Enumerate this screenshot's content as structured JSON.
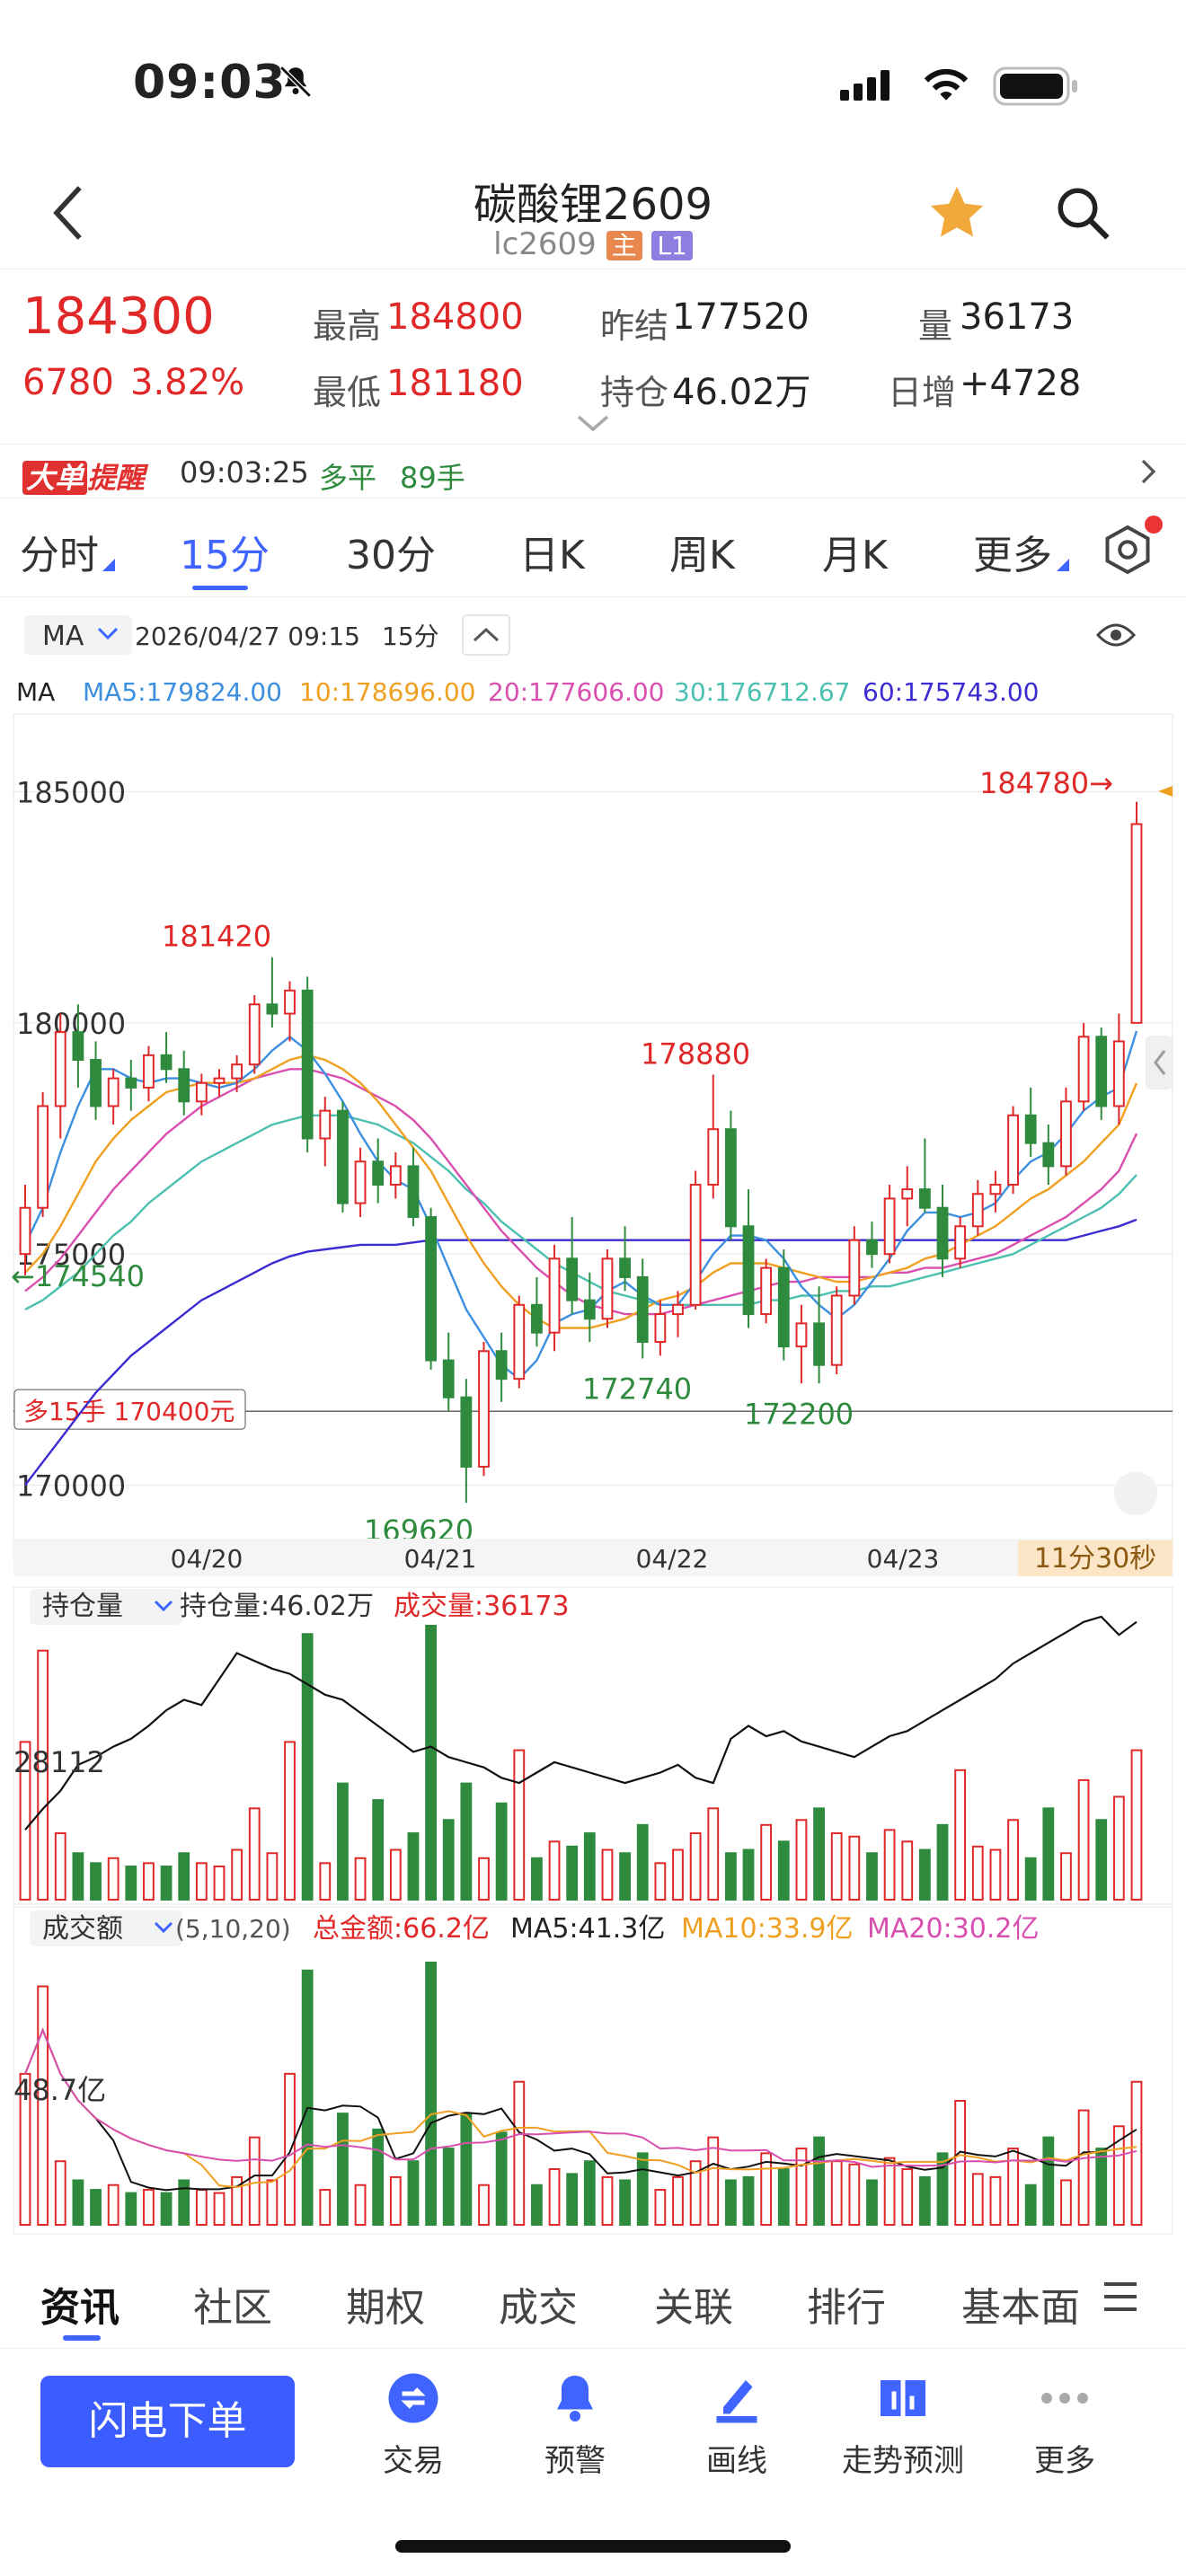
{
  "status_bar": {
    "time": "09:03"
  },
  "header": {
    "title": "碳酸锂2609",
    "code": "lc2609",
    "badge_main": "主",
    "badge_l1": "L1"
  },
  "quote": {
    "last_price": "184300",
    "change": "6780",
    "change_pct": "3.82%",
    "high_label": "最高",
    "high": "184800",
    "low_label": "最低",
    "low": "181180",
    "prev_settle_label": "昨结",
    "prev_settle": "177520",
    "oi_label": "持仓",
    "oi": "46.02万",
    "vol_label": "量",
    "vol": "36173",
    "daily_inc_label": "日增",
    "daily_inc": "+4728"
  },
  "alert": {
    "tag1": "大单",
    "tag2": "提醒",
    "time": "09:03:25",
    "type": "多平",
    "qty": "89手"
  },
  "period_tabs": [
    "分时",
    "15分",
    "30分",
    "日K",
    "周K",
    "月K",
    "更多"
  ],
  "active_period": "15分",
  "chart_header": {
    "indicator": "MA",
    "datetime": "2026/04/27 09:15",
    "period": "15分"
  },
  "ma_legend": {
    "label": "MA",
    "ma5": "MA5:179824.00",
    "ma10": "10:178696.00",
    "ma20": "20:177606.00",
    "ma30": "30:176712.67",
    "ma60": "60:175743.00"
  },
  "colors": {
    "up": "#e02828",
    "down": "#2e8b3d",
    "ma5": "#3d8fe0",
    "ma10": "#f0a020",
    "ma20": "#d94fb0",
    "ma30": "#4cc0b0",
    "ma60": "#3b2bd0",
    "accent": "#3f64ff"
  },
  "price_labels": {
    "y185000": "185000",
    "y180000": "180000",
    "y175000": "175000",
    "y170000": "170000",
    "high_mark": "181420",
    "hi2": "178880",
    "low_mark": "169620",
    "low2": "172740",
    "low3": "172200",
    "current_arrow": "184780→",
    "left_arrow": "←174540",
    "position_line": "多15手 170400元"
  },
  "date_axis": [
    "04/20",
    "04/21",
    "04/22",
    "04/23"
  ],
  "countdown": "11分30秒",
  "oi_panel": {
    "selector": "持仓量",
    "oi_text": "持仓量:46.02万",
    "vol_text": "成交量:36173",
    "level": "28112"
  },
  "amount_panel": {
    "selector": "成交额",
    "params": "(5,10,20)",
    "total": "总金额:66.2亿",
    "ma5": "MA5:41.3亿",
    "ma10": "MA10:33.9亿",
    "ma20": "MA20:30.2亿",
    "level": "48.7亿"
  },
  "bottom_tabs": [
    "资讯",
    "社区",
    "期权",
    "成交",
    "关联",
    "排行",
    "基本面"
  ],
  "toolbar": {
    "order_button": "闪电下单",
    "items": [
      "交易",
      "预警",
      "画线",
      "走势预测",
      "更多"
    ]
  },
  "chart_data": {
    "type": "candlestick",
    "ylim": [
      169000,
      186000
    ],
    "candles": [
      [
        175000,
        176500,
        174540,
        176000
      ],
      [
        176000,
        178500,
        175800,
        178200
      ],
      [
        178200,
        180200,
        177500,
        179800
      ],
      [
        179800,
        180400,
        178600,
        179200
      ],
      [
        179200,
        179600,
        177900,
        178200
      ],
      [
        178200,
        179000,
        177800,
        178800
      ],
      [
        178800,
        179200,
        178100,
        178600
      ],
      [
        178600,
        179500,
        178300,
        179300
      ],
      [
        179300,
        179800,
        178700,
        179000
      ],
      [
        179000,
        179400,
        178000,
        178300
      ],
      [
        178300,
        178900,
        178000,
        178700
      ],
      [
        178700,
        179000,
        178400,
        178800
      ],
      [
        178800,
        179300,
        178500,
        179100
      ],
      [
        179100,
        180600,
        178900,
        180400
      ],
      [
        180400,
        181420,
        179900,
        180200
      ],
      [
        180200,
        180900,
        179600,
        180700
      ],
      [
        180700,
        181000,
        177200,
        177500
      ],
      [
        177500,
        178400,
        176900,
        178100
      ],
      [
        178100,
        178300,
        175900,
        176100
      ],
      [
        176100,
        177300,
        175800,
        177000
      ],
      [
        177000,
        177500,
        176100,
        176500
      ],
      [
        176500,
        177200,
        176200,
        176900
      ],
      [
        176900,
        177300,
        175600,
        175800
      ],
      [
        175800,
        176000,
        172500,
        172700
      ],
      [
        172700,
        173300,
        171600,
        171900
      ],
      [
        171900,
        172300,
        169620,
        170400
      ],
      [
        170400,
        173100,
        170200,
        172900
      ],
      [
        172900,
        173300,
        171800,
        172300
      ],
      [
        172300,
        174100,
        172100,
        173900
      ],
      [
        173900,
        174500,
        173000,
        173300
      ],
      [
        173300,
        175200,
        172900,
        174900
      ],
      [
        174900,
        175800,
        173700,
        174000
      ],
      [
        174000,
        174600,
        173100,
        173600
      ],
      [
        173600,
        175100,
        173400,
        174900
      ],
      [
        174900,
        175600,
        174200,
        174500
      ],
      [
        174500,
        174900,
        172740,
        173100
      ],
      [
        173100,
        174000,
        172800,
        173700
      ],
      [
        173700,
        174200,
        173200,
        173900
      ],
      [
        173900,
        176800,
        173800,
        176500
      ],
      [
        176500,
        178880,
        176200,
        177700
      ],
      [
        177700,
        178100,
        175300,
        175600
      ],
      [
        175600,
        176400,
        173400,
        173700
      ],
      [
        173700,
        174900,
        173500,
        174700
      ],
      [
        174700,
        175100,
        172700,
        173000
      ],
      [
        173000,
        173900,
        172200,
        173500
      ],
      [
        173500,
        174300,
        172200,
        172600
      ],
      [
        172600,
        174300,
        172400,
        174100
      ],
      [
        174100,
        175600,
        173900,
        175300
      ],
      [
        175300,
        175700,
        174700,
        175000
      ],
      [
        175000,
        176500,
        174800,
        176200
      ],
      [
        176200,
        176900,
        175600,
        176400
      ],
      [
        176400,
        177500,
        175900,
        176000
      ],
      [
        176000,
        176500,
        174500,
        174900
      ],
      [
        174900,
        175800,
        174700,
        175600
      ],
      [
        175600,
        176600,
        175400,
        176300
      ],
      [
        176300,
        176800,
        175900,
        176500
      ],
      [
        176500,
        178200,
        176300,
        178000
      ],
      [
        178000,
        178600,
        177100,
        177400
      ],
      [
        177400,
        177800,
        176500,
        176900
      ],
      [
        176900,
        178600,
        176700,
        178300
      ],
      [
        178300,
        180000,
        178100,
        179700
      ],
      [
        179700,
        179900,
        177900,
        178200
      ],
      [
        178200,
        180200,
        177800,
        179600
      ],
      [
        180000,
        184780,
        181180,
        184300
      ]
    ],
    "ma": {
      "ma5": [
        175200,
        176000,
        177200,
        178200,
        179000,
        179000,
        178800,
        178700,
        178800,
        178800,
        178700,
        178600,
        178700,
        179000,
        179400,
        179700,
        179400,
        178900,
        178300,
        177600,
        177000,
        176600,
        176400,
        175600,
        174700,
        173800,
        173200,
        172600,
        172300,
        172700,
        173500,
        173700,
        173800,
        174200,
        174400,
        174100,
        173900,
        173900,
        174400,
        175000,
        175400,
        175400,
        175300,
        174900,
        174300,
        173900,
        173600,
        173900,
        174400,
        174900,
        175500,
        175900,
        175900,
        175800,
        175900,
        176100,
        176600,
        177000,
        177200,
        177600,
        178100,
        178400,
        178600,
        179824
      ],
      "ma10": [
        174600,
        175000,
        175600,
        176300,
        177000,
        177500,
        177900,
        178200,
        178500,
        178600,
        178700,
        178700,
        178700,
        178800,
        179000,
        179200,
        179300,
        179200,
        179000,
        178700,
        178300,
        177800,
        177300,
        176800,
        176100,
        175400,
        174800,
        174300,
        173900,
        173600,
        173400,
        173400,
        173400,
        173500,
        173600,
        173800,
        174000,
        174100,
        174300,
        174600,
        174800,
        174800,
        174800,
        174700,
        174600,
        174500,
        174400,
        174400,
        174500,
        174600,
        174700,
        174900,
        175000,
        175200,
        175400,
        175600,
        175900,
        176200,
        176400,
        176700,
        177000,
        177400,
        177800,
        178696
      ],
      "ma20": [
        174200,
        174500,
        174900,
        175400,
        175900,
        176400,
        176800,
        177200,
        177600,
        177900,
        178200,
        178400,
        178600,
        178800,
        178900,
        179000,
        179000,
        178900,
        178800,
        178600,
        178400,
        178200,
        177900,
        177500,
        177000,
        176500,
        176000,
        175500,
        175100,
        174700,
        174400,
        174100,
        173900,
        173800,
        173700,
        173700,
        173700,
        173800,
        173900,
        174000,
        174100,
        174200,
        174300,
        174400,
        174400,
        174500,
        174500,
        174500,
        174500,
        174600,
        174600,
        174700,
        174700,
        174800,
        174900,
        175000,
        175200,
        175400,
        175600,
        175800,
        176100,
        176400,
        176800,
        177606
      ],
      "ma30": [
        173800,
        174000,
        174300,
        174600,
        175000,
        175400,
        175700,
        176100,
        176400,
        176700,
        177000,
        177200,
        177400,
        177600,
        177800,
        177900,
        178000,
        178000,
        178000,
        177900,
        177800,
        177600,
        177400,
        177100,
        176800,
        176400,
        176100,
        175700,
        175400,
        175100,
        174800,
        174600,
        174400,
        174200,
        174100,
        174000,
        173900,
        173900,
        173900,
        173900,
        173900,
        173900,
        174000,
        174000,
        174100,
        174100,
        174200,
        174200,
        174300,
        174300,
        174400,
        174500,
        174600,
        174700,
        174800,
        174900,
        175000,
        175200,
        175400,
        175600,
        175800,
        176000,
        176300,
        176712
      ],
      "ma60": [
        170000,
        170500,
        171000,
        171500,
        172000,
        172400,
        172800,
        173100,
        173400,
        173700,
        174000,
        174200,
        174400,
        174600,
        174800,
        174950,
        175050,
        175100,
        175150,
        175200,
        175200,
        175200,
        175250,
        175300,
        175300,
        175300,
        175300,
        175300,
        175300,
        175300,
        175300,
        175300,
        175300,
        175300,
        175300,
        175300,
        175300,
        175300,
        175300,
        175300,
        175300,
        175300,
        175300,
        175300,
        175300,
        175300,
        175300,
        175300,
        175300,
        175300,
        175300,
        175300,
        175300,
        175300,
        175300,
        175300,
        175300,
        175300,
        175300,
        175300,
        175400,
        175500,
        175600,
        175743
      ]
    },
    "volume": [
      95,
      150,
      40,
      28,
      22,
      25,
      20,
      22,
      20,
      28,
      22,
      20,
      30,
      55,
      28,
      95,
      160,
      22,
      70,
      25,
      60,
      30,
      40,
      165,
      48,
      70,
      25,
      58,
      90,
      25,
      35,
      32,
      40,
      30,
      28,
      45,
      22,
      30,
      40,
      55,
      28,
      30,
      45,
      35,
      48,
      55,
      40,
      38,
      28,
      42,
      35,
      30,
      45,
      78,
      32,
      30,
      48,
      25,
      55,
      28,
      72,
      48,
      62,
      90
    ],
    "volume_up": [
      true,
      true,
      true,
      false,
      false,
      true,
      false,
      true,
      false,
      false,
      true,
      true,
      true,
      true,
      true,
      true,
      false,
      true,
      false,
      true,
      false,
      true,
      false,
      false,
      false,
      false,
      true,
      false,
      true,
      false,
      true,
      false,
      false,
      true,
      false,
      false,
      true,
      true,
      true,
      true,
      false,
      false,
      true,
      false,
      true,
      false,
      true,
      true,
      false,
      true,
      true,
      false,
      false,
      true,
      true,
      true,
      true,
      false,
      false,
      true,
      true,
      false,
      true,
      true
    ],
    "amount": [
      95,
      150,
      40,
      28,
      22,
      25,
      20,
      22,
      20,
      28,
      22,
      20,
      30,
      55,
      28,
      95,
      160,
      22,
      70,
      25,
      60,
      30,
      40,
      165,
      48,
      70,
      25,
      58,
      90,
      25,
      35,
      32,
      40,
      30,
      28,
      45,
      22,
      30,
      40,
      55,
      28,
      30,
      45,
      35,
      48,
      55,
      40,
      38,
      28,
      42,
      35,
      30,
      45,
      78,
      32,
      30,
      48,
      25,
      55,
      28,
      72,
      48,
      62,
      90
    ],
    "open_interest": [
      20,
      28,
      35,
      45,
      48,
      52,
      55,
      60,
      66,
      70,
      68,
      78,
      88,
      85,
      82,
      80,
      76,
      72,
      70,
      65,
      60,
      55,
      50,
      52,
      48,
      46,
      44,
      40,
      38,
      42,
      46,
      44,
      42,
      40,
      38,
      40,
      42,
      45,
      40,
      38,
      55,
      60,
      56,
      58,
      54,
      52,
      50,
      48,
      52,
      56,
      58,
      62,
      66,
      70,
      74,
      78,
      84,
      88,
      92,
      96,
      100,
      102,
      95,
      100
    ],
    "dates": [
      "04/20",
      "04/21",
      "04/22",
      "04/23"
    ]
  }
}
